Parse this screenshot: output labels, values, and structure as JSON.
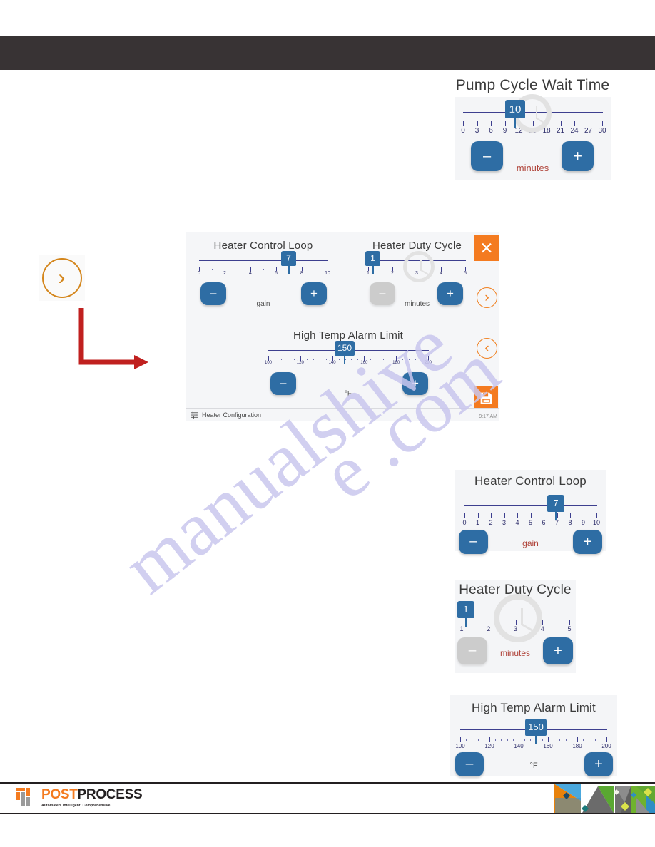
{
  "page": {
    "watermark_line1": "manualshive",
    "watermark_line2": "e .com"
  },
  "header": {
    "title": ""
  },
  "pump_cycle_panel": {
    "title": "Pump Cycle Wait Time",
    "value": "10",
    "unit": "minutes",
    "minus_label": "–",
    "plus_label": "+",
    "ticks": [
      "0",
      "3",
      "6",
      "9",
      "12",
      "15",
      "18",
      "21",
      "24",
      "27",
      "30"
    ],
    "scale_min": 0,
    "scale_max": 30
  },
  "main_panel": {
    "status_label": "Heater Configuration",
    "status_icon": "sliders-icon",
    "time": "9:17 AM",
    "close_label": "✕",
    "next_label": "›",
    "prev_label": "‹",
    "save_icon": "floppy-disk-icon",
    "control_loop": {
      "title": "Heater Control Loop",
      "value": "7",
      "unit": "gain",
      "minus_label": "–",
      "plus_label": "+",
      "ticks": [
        "0",
        "2",
        "4",
        "6",
        "8",
        "10"
      ],
      "scale_min": 0,
      "scale_max": 10
    },
    "duty_cycle": {
      "title": "Heater Duty Cycle",
      "value": "1",
      "unit": "minutes",
      "minus_label": "–",
      "plus_label": "+",
      "minus_disabled": true,
      "ticks": [
        "1",
        "2",
        "3",
        "4",
        "5"
      ],
      "scale_min": 1,
      "scale_max": 5
    },
    "alarm_limit": {
      "title": "High Temp Alarm Limit",
      "value": "150",
      "unit": "°F",
      "minus_label": "–",
      "plus_label": "+",
      "ticks": [
        "100",
        "120",
        "140",
        "160",
        "180",
        "200"
      ],
      "scale_min": 100,
      "scale_max": 200
    }
  },
  "left_nav": {
    "chevron_label": "›"
  },
  "detail_control_loop": {
    "title": "Heater Control Loop",
    "value": "7",
    "unit": "gain",
    "minus_label": "–",
    "plus_label": "+",
    "ticks": [
      "0",
      "1",
      "2",
      "3",
      "4",
      "5",
      "6",
      "7",
      "8",
      "9",
      "10"
    ],
    "scale_min": 0,
    "scale_max": 10
  },
  "detail_duty_cycle": {
    "title": "Heater Duty Cycle",
    "value": "1",
    "unit": "minutes",
    "minus_label": "–",
    "plus_label": "+",
    "minus_disabled": true,
    "ticks": [
      "1",
      "2",
      "3",
      "4",
      "5"
    ],
    "scale_min": 1,
    "scale_max": 5
  },
  "detail_alarm_limit": {
    "title": "High Temp Alarm Limit",
    "value": "150",
    "unit": "°F",
    "minus_label": "–",
    "plus_label": "+",
    "ticks": [
      "100",
      "120",
      "140",
      "160",
      "180",
      "200"
    ],
    "scale_min": 100,
    "scale_max": 200
  },
  "footer": {
    "logo_part1": "POST",
    "logo_part2": "PROCESS",
    "tagline": "Automated. Intelligent. Comprehensive.",
    "brand_orange": "#f47b20",
    "brand_dark": "#231f20"
  }
}
